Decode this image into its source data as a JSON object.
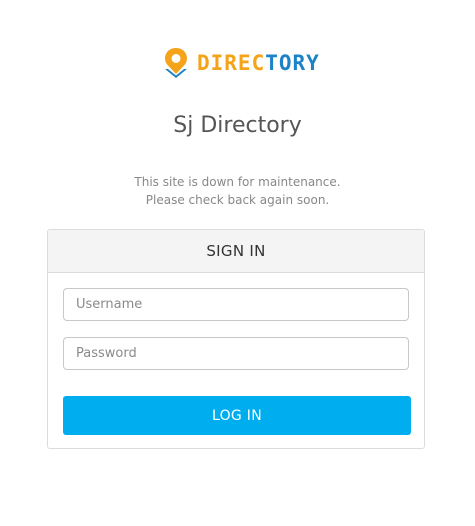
{
  "logo": {
    "text_part1": "DIREC",
    "text_part2": "TORY",
    "icon": "map-pin-icon",
    "colors": {
      "orange": "#f5a31a",
      "blue": "#1c83c6"
    }
  },
  "site_title": "Sj Directory",
  "maintenance": {
    "line1": "This site is down for maintenance.",
    "line2": "Please check back again soon."
  },
  "signin": {
    "heading": "SIGN IN",
    "username_placeholder": "Username",
    "username_value": "",
    "password_placeholder": "Password",
    "password_value": "",
    "button_label": "LOG IN",
    "button_color": "#00aeef"
  }
}
